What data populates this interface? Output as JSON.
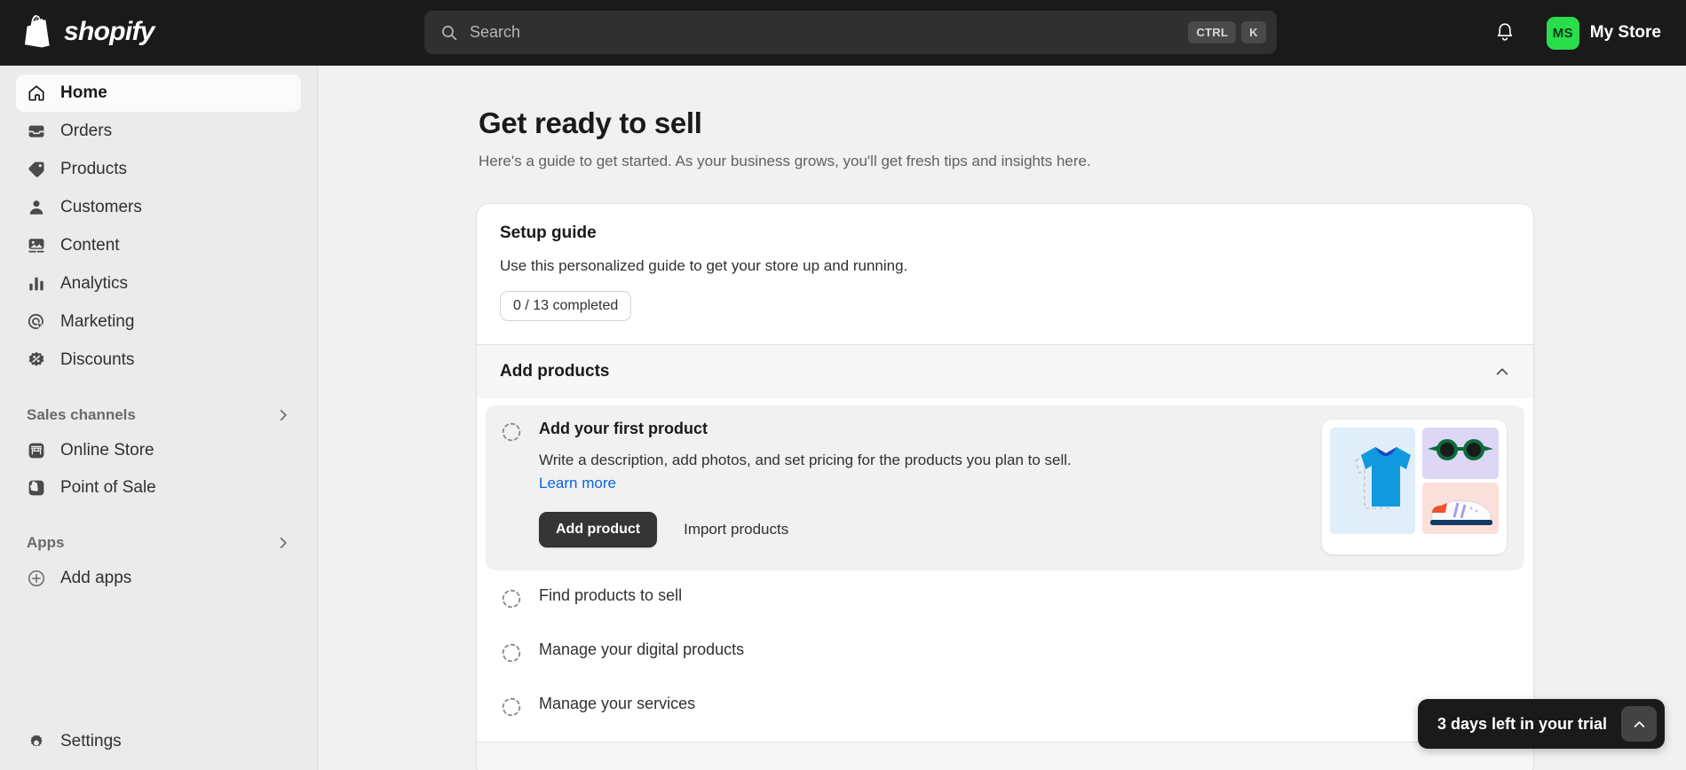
{
  "topbar": {
    "logo_text": "shopify",
    "search": {
      "placeholder": "Search",
      "value": "",
      "key1": "CTRL",
      "key2": "K"
    },
    "notifications_icon": "bell-icon",
    "store": {
      "initials": "MS",
      "name": "My Store",
      "avatar_color": "#2bdd4b"
    }
  },
  "sidebar": {
    "items": [
      {
        "label": "Home",
        "icon": "home-icon",
        "active": true
      },
      {
        "label": "Orders",
        "icon": "orders-icon",
        "active": false
      },
      {
        "label": "Products",
        "icon": "products-tag-icon",
        "active": false
      },
      {
        "label": "Customers",
        "icon": "customers-person-icon",
        "active": false
      },
      {
        "label": "Content",
        "icon": "content-image-icon",
        "active": false
      },
      {
        "label": "Analytics",
        "icon": "analytics-bars-icon",
        "active": false
      },
      {
        "label": "Marketing",
        "icon": "marketing-target-icon",
        "active": false
      },
      {
        "label": "Discounts",
        "icon": "discounts-badge-icon",
        "active": false
      }
    ],
    "sales_channels": {
      "title": "Sales channels",
      "items": [
        {
          "label": "Online Store",
          "icon": "storefront-icon"
        },
        {
          "label": "Point of Sale",
          "icon": "pos-icon"
        }
      ]
    },
    "apps": {
      "title": "Apps",
      "items": [
        {
          "label": "Add apps",
          "icon": "plus-circle-icon"
        }
      ]
    },
    "settings": {
      "label": "Settings",
      "icon": "gear-icon"
    }
  },
  "main": {
    "title": "Get ready to sell",
    "subtitle": "Here's a guide to get started. As your business grows, you'll get fresh tips and insights here.",
    "setup_guide": {
      "title": "Setup guide",
      "description": "Use this personalized guide to get your store up and running.",
      "progress_badge": "0 / 13 completed",
      "completed": 0,
      "total": 13
    },
    "group": {
      "title": "Add products",
      "expanded": true,
      "collapse_icon": "chevron-up-icon"
    },
    "tasks": [
      {
        "title": "Add your first product",
        "description": "Write a description, add photos, and set pricing for the products you plan to sell.",
        "link_label": "Learn more",
        "primary_button": "Add product",
        "secondary_button": "Import products",
        "open": true,
        "status_icon": "incomplete-dashed-circle-icon"
      },
      {
        "title": "Find products to sell",
        "open": false,
        "status_icon": "incomplete-dashed-circle-icon"
      },
      {
        "title": "Manage your digital products",
        "open": false,
        "status_icon": "incomplete-dashed-circle-icon"
      },
      {
        "title": "Manage your services",
        "open": false,
        "status_icon": "incomplete-dashed-circle-icon"
      }
    ]
  },
  "trial": {
    "text": "3 days left in your trial",
    "toggle_icon": "chevron-up-icon"
  },
  "colors": {
    "topbar_bg": "#1a1a1a",
    "accent_link": "#0a64e0",
    "avatar_green": "#2bdd4b",
    "primary_button": "#353535"
  }
}
